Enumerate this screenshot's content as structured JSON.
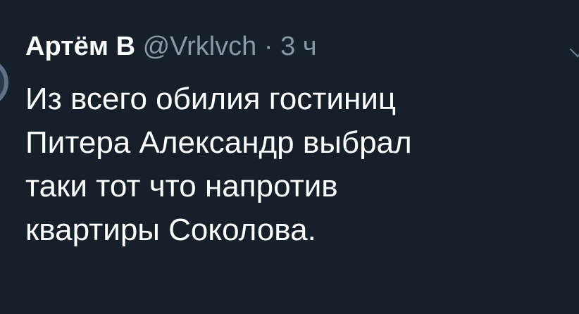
{
  "tweet": {
    "author_name": "Артём В",
    "handle": "@Vrklvch",
    "separator": "·",
    "time": "3 ч",
    "text_lines": [
      "Из всего обилия гостиниц",
      "Питера Александр выбрал",
      "таки тот что напротив",
      "квартиры Соколова."
    ]
  },
  "icons": {
    "menu": "chevron-down-icon"
  },
  "colors": {
    "background": "#15202b",
    "primary_text": "#ffffff",
    "secondary_text": "#8899a6"
  }
}
